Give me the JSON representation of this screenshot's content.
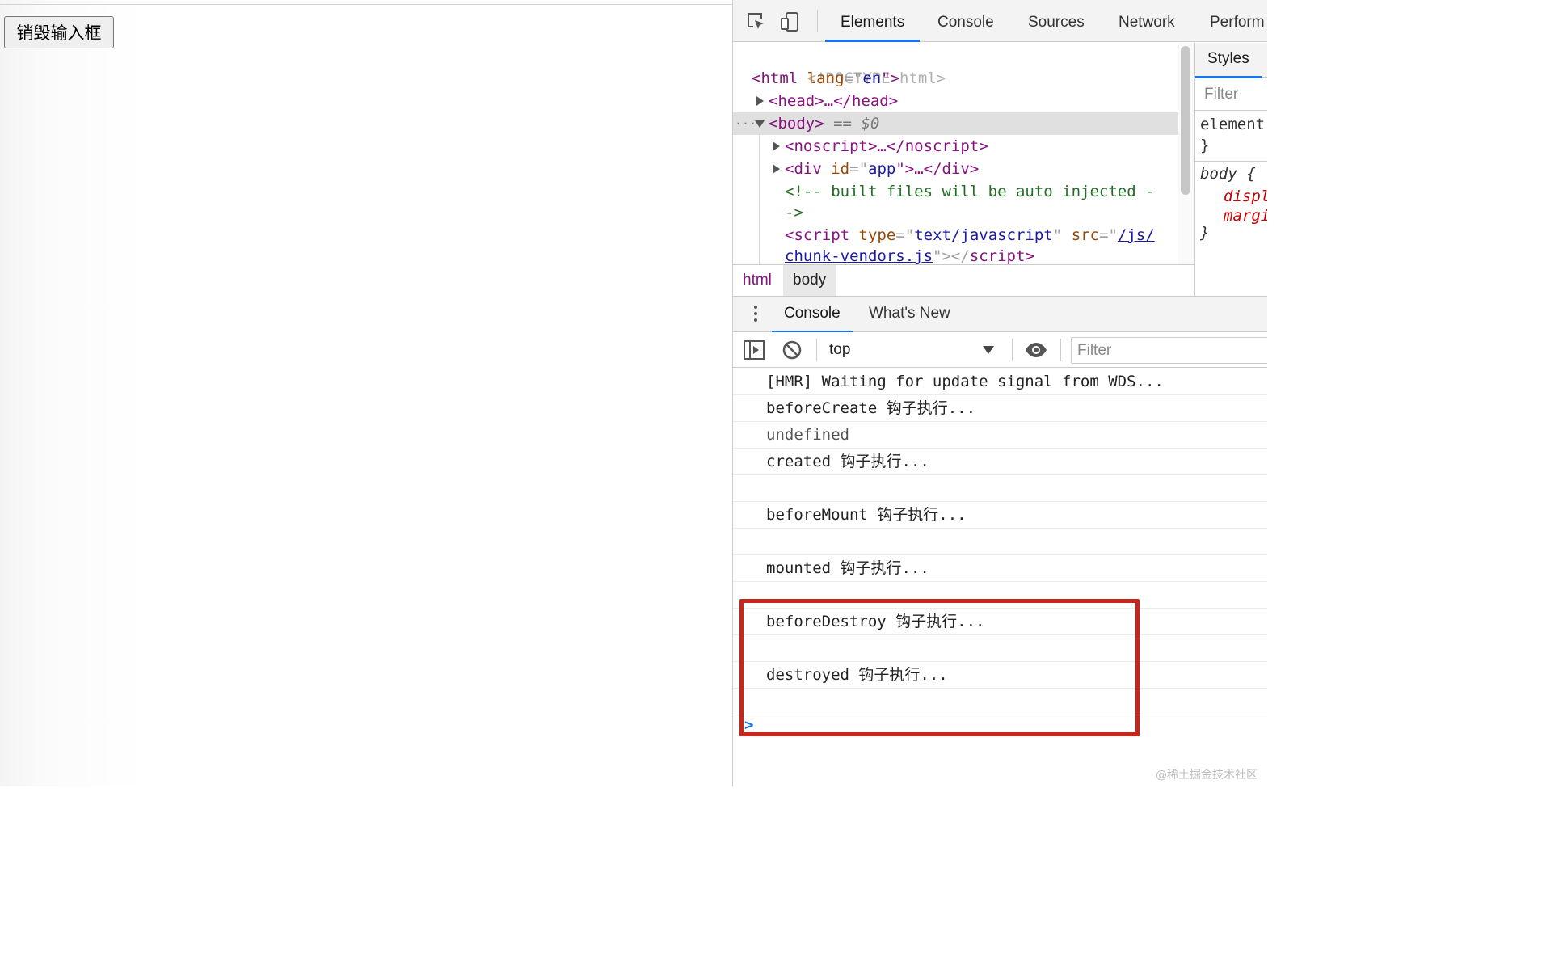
{
  "page": {
    "destroy_button_label": "销毁输入框"
  },
  "devtools": {
    "main_tabs": [
      {
        "label": "Elements"
      },
      {
        "label": "Console"
      },
      {
        "label": "Sources"
      },
      {
        "label": "Network"
      },
      {
        "label": "Perform"
      }
    ],
    "active_main_tab": "Elements",
    "icons": [
      "inspect-element-icon",
      "device-toolbar-icon"
    ],
    "elements": {
      "lines": [
        {
          "doctype": "<!DOCTYPE html>"
        },
        {
          "open": "<",
          "tag": "html",
          "attr": "lang",
          "eq": "=\"",
          "val": "en",
          "close": "\">"
        },
        {
          "open": "<",
          "tag": "head",
          "mid": ">…</",
          "tag2": "head",
          "close": ">"
        },
        {
          "dots": "···",
          "open": "<",
          "tag": "body",
          "close": ">",
          "eq_dollar": " == ",
          "dollar": "$0"
        },
        {
          "open": "<",
          "tag": "noscript",
          "mid": ">…</",
          "tag2": "noscript",
          "close": ">"
        },
        {
          "open": "<",
          "tag": "div",
          "attr": "id",
          "eq": "=\"",
          "val": "app",
          "mid": "\">…</",
          "tag2": "div",
          "close": ">"
        },
        {
          "comment": "<!-- built files will be auto injected -"
        },
        {
          "comment": "->"
        },
        {
          "open": "<",
          "tag": "script",
          "attr": "type",
          "eq": "=\"",
          "val": "text/javascript",
          "q": "\" ",
          "attr2": "src",
          "eq2": "=\"",
          "link": "/js/"
        },
        {
          "link": "chunk-vendors.js",
          "q": "\"></",
          "tag2": "script",
          "close": ">"
        }
      ]
    },
    "breadcrumbs": [
      "html",
      "body"
    ],
    "styles": {
      "tab_label": "Styles",
      "filter_placeholder": "Filter",
      "lines": [
        "element",
        "}",
        "body {",
        "displ",
        "margi",
        "}"
      ]
    },
    "drawer": {
      "tabs": [
        {
          "label": "Console"
        },
        {
          "label": "What's New"
        }
      ],
      "active_tab": "Console"
    },
    "console_toolbar": {
      "context": "top",
      "filter_placeholder": "Filter"
    },
    "console_messages": [
      "[HMR] Waiting for update signal from WDS...",
      "beforeCreate 钩子执行...",
      "undefined",
      "created 钩子执行...",
      "",
      "beforeMount 钩子执行...",
      "",
      "mounted 钩子执行...",
      "",
      "beforeDestroy 钩子执行...",
      "",
      "destroyed 钩子执行...",
      ""
    ],
    "prompt_symbol": ">"
  },
  "annotation": {
    "color": "#c8261d"
  },
  "watermark": "@稀土掘金技术社区"
}
